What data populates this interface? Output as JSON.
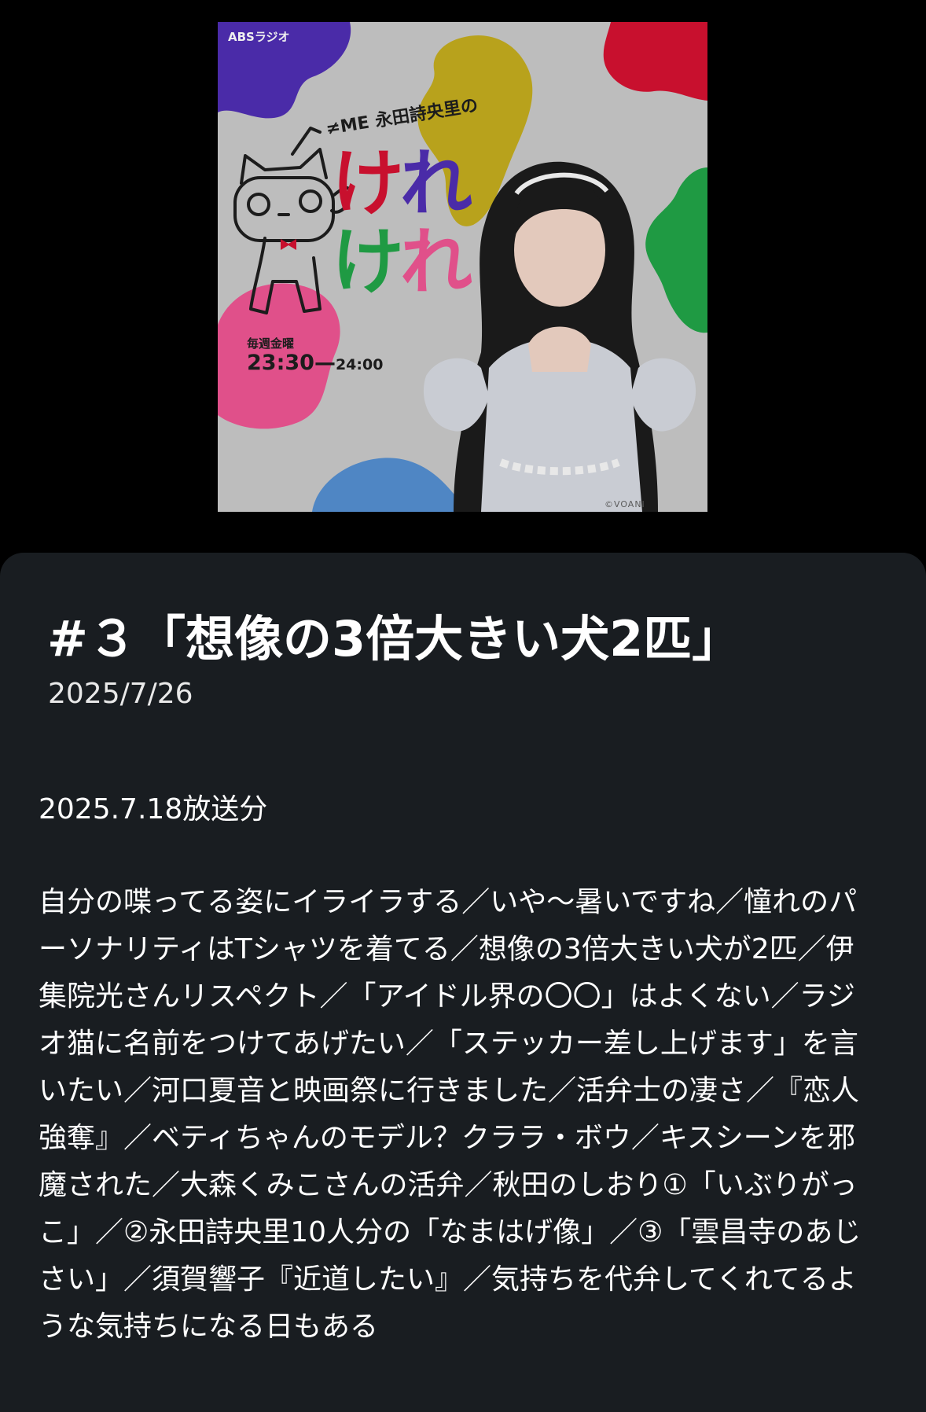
{
  "artwork": {
    "station": "ABSラジオ",
    "prefix_group": "≠ME",
    "prefix_name": "永田詩央里の",
    "title_row1": [
      "け",
      "れ"
    ],
    "title_row2": [
      "け",
      "れ"
    ],
    "schedule_days": "毎週金曜",
    "schedule_start": "23:30",
    "schedule_end": "24:00",
    "credit": "©VOANI",
    "colors": {
      "purple": "#4a2ba8",
      "yellow": "#b8a21c",
      "red": "#c8102e",
      "green": "#1f9a43",
      "pink": "#e0508a",
      "blue": "#4f86c4",
      "background": "#bdbdbd"
    }
  },
  "episode": {
    "title": "#３「想像の3倍大きい犬2匹」",
    "date": "2025/7/26",
    "broadcast": "2025.7.18放送分",
    "description": "自分の喋ってる姿にイライラする／いや〜暑いですね／憧れのパーソナリティはTシャツを着てる／想像の3倍大きい犬が2匹／伊集院光さんリスペクト／「アイドル界の〇〇」はよくない／ラジオ猫に名前をつけてあげたい／「ステッカー差し上げます」を言いたい／河口夏音と映画祭に行きました／活弁士の凄さ／『恋人強奪』／ベティちゃんのモデル？クララ・ボウ／キスシーンを邪魔された／大森くみこさんの活弁／秋田のしおり①「いぶりがっこ」／②永田詩央里10人分の「なまはげ像」／③「雲昌寺のあじさい」／須賀響子『近道したい』／気持ちを代弁してくれてるような気持ちになる日もある"
  }
}
